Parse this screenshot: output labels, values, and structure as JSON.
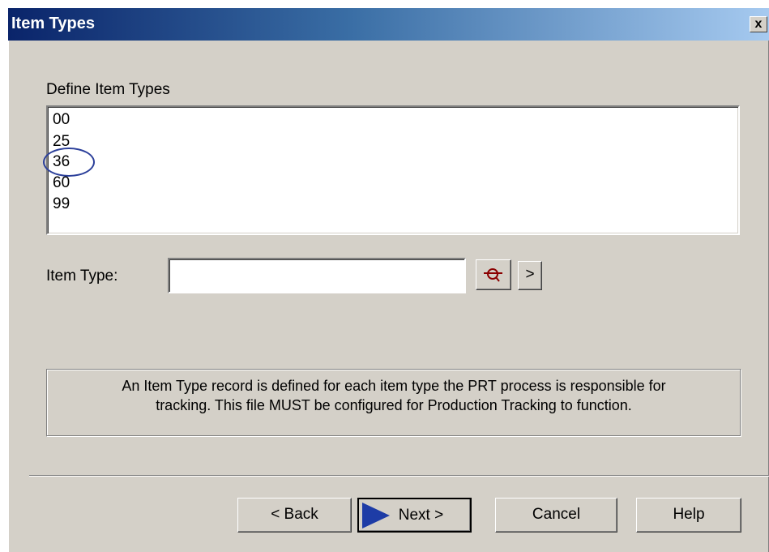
{
  "window": {
    "title": "Item Types",
    "close_glyph": "x"
  },
  "list": {
    "label": "Define Item Types",
    "items": [
      "00",
      "25",
      "36",
      "60",
      "99"
    ],
    "highlighted_item": "36"
  },
  "item_type": {
    "label": "Item Type:",
    "value": ""
  },
  "lookup_button": {
    "icon": "search-icon"
  },
  "next_field_button": {
    "label": ">"
  },
  "info": {
    "line1": "An Item Type record is defined for each item type the PRT process is responsible for",
    "line2": "tracking.  This file MUST be configured for Production Tracking to function."
  },
  "buttons": {
    "back": "< Back",
    "next": "Next >",
    "cancel": "Cancel",
    "help": "Help"
  },
  "colors": {
    "title_start": "#0a246a",
    "title_end": "#a6caf0",
    "highlight_ring": "#2b3f9a",
    "arrow": "#1e3ca6"
  }
}
